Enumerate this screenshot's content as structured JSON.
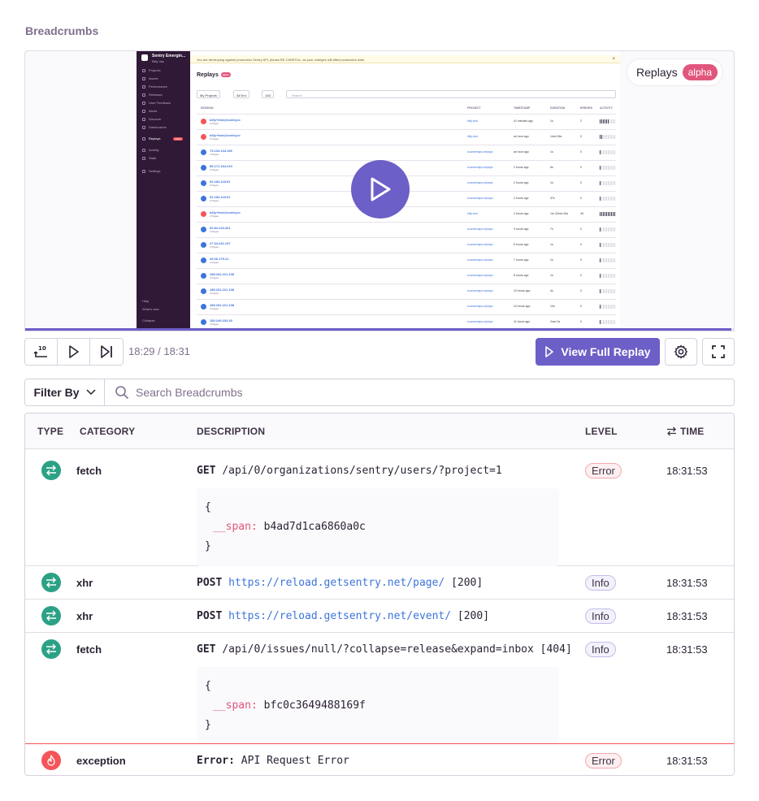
{
  "section_title": "Breadcrumbs",
  "player": {
    "badge_label": "Replays",
    "badge_tag": "alpha",
    "progress": 0.996,
    "timecode": "18:29 / 18:31",
    "view_full_label": "View Full Replay",
    "accent": "#6c5fc7"
  },
  "replay_screenshot": {
    "org_name": "Sentry Emergin...",
    "org_user": "Billy Vaz",
    "nav": [
      "Projects",
      "Issues",
      "Performance",
      "Releases",
      "User Feedback",
      "Alerts",
      "Discover",
      "Dashboards",
      "Replays",
      "Activity",
      "Stats",
      "Settings"
    ],
    "nav_badge": "alpha",
    "footer": [
      "Help",
      "What's new",
      "Collapse"
    ],
    "banner": "You are developing against production Sentry API, please BE CAREFUL, as your changes will affect production data",
    "title": "Replays",
    "title_badge": "alpha",
    "filters": [
      "My Projects",
      "All Env",
      "14D"
    ],
    "search_placeholder": "Search",
    "headers": [
      "SESSION",
      "PROJECT",
      "TIMESTAMP",
      "DURATION",
      "ERRORS",
      "ACTIVITY"
    ],
    "rows": [
      {
        "name": "billy+test@sentry.io",
        "sub": "3 Pages",
        "project": "billy-test",
        "ts": "41 minutes ago",
        "dur": "1s",
        "err": "2",
        "act": 0.6,
        "color": "#f55459"
      },
      {
        "name": "billy+test@sentry.io",
        "sub": "2 Pages",
        "project": "billy-test",
        "ts": "an hour ago",
        "dur": "1min 36s",
        "err": "0",
        "act": 0.2,
        "color": "#f55459"
      },
      {
        "name": "73.134.134.156",
        "sub": "3 Pages",
        "project": "sourcemaps-replays",
        "ts": "an hour ago",
        "dur": "1s",
        "err": "0",
        "act": 0.1,
        "color": "#3d74db"
      },
      {
        "name": "89.171.164.210",
        "sub": "2 Pages",
        "project": "sourcemaps-replays",
        "ts": "2 hours ago",
        "dur": "6s",
        "err": "0",
        "act": 0.1,
        "color": "#3d74db"
      },
      {
        "name": "92.184.118.91",
        "sub": "2 Pages",
        "project": "sourcemaps-replays",
        "ts": "2 hours ago",
        "dur": "1s",
        "err": "0",
        "act": 0.1,
        "color": "#3d74db"
      },
      {
        "name": "92.184.118.91",
        "sub": "2 Pages",
        "project": "sourcemaps-replays",
        "ts": "2 hours ago",
        "dur": "37s",
        "err": "0",
        "act": 0.1,
        "color": "#3d74db"
      },
      {
        "name": "billy+test@sentry.io",
        "sub": "2 Pages",
        "project": "billy-test",
        "ts": "2 hours ago",
        "dur": "1hr 42min 34s",
        "err": "49",
        "act": 1.0,
        "color": "#f55459"
      },
      {
        "name": "60.84.133.201",
        "sub": "2 Pages",
        "project": "sourcemaps-replays",
        "ts": "3 hours ago",
        "dur": "7s",
        "err": "0",
        "act": 0.1,
        "color": "#3d74db"
      },
      {
        "name": "27.34.241.137",
        "sub": "2 Pages",
        "project": "sourcemaps-replays",
        "ts": "6 hours ago",
        "dur": "1s",
        "err": "0",
        "act": 0.1,
        "color": "#3d74db"
      },
      {
        "name": "49.36.179.21",
        "sub": "2 Pages",
        "project": "sourcemaps-replays",
        "ts": "7 hours ago",
        "dur": "1s",
        "err": "0",
        "act": 0.1,
        "color": "#3d74db"
      },
      {
        "name": "185.202.221.108",
        "sub": "2 Pages",
        "project": "sourcemaps-replays",
        "ts": "8 hours ago",
        "dur": "1s",
        "err": "0",
        "act": 0.1,
        "color": "#3d74db"
      },
      {
        "name": "185.202.221.108",
        "sub": "2 Pages",
        "project": "sourcemaps-replays",
        "ts": "10 hours ago",
        "dur": "4s",
        "err": "0",
        "act": 0.1,
        "color": "#3d74db"
      },
      {
        "name": "185.202.221.108",
        "sub": "2 Pages",
        "project": "sourcemaps-replays",
        "ts": "10 hours ago",
        "dur": "10s",
        "err": "0",
        "act": 0.1,
        "color": "#3d74db"
      },
      {
        "name": "180.249.233.49",
        "sub": "2 Pages",
        "project": "sourcemaps-replays",
        "ts": "11 hours ago",
        "dur": "2min 2s",
        "err": "0",
        "act": 0.1,
        "color": "#3d74db"
      }
    ]
  },
  "filter": {
    "label": "Filter By",
    "search_placeholder": "Search Breadcrumbs"
  },
  "table": {
    "headers": {
      "type": "TYPE",
      "category": "CATEGORY",
      "description": "DESCRIPTION",
      "level": "LEVEL",
      "time": "TIME"
    },
    "rows": [
      {
        "category": "fetch",
        "method": "GET",
        "url": "/api/0/organizations/sentry/users/?project=1",
        "suffix": "",
        "link": false,
        "level": "Error",
        "level_kind": "err",
        "time": "18:31:53",
        "icon": "arrows-exchange-icon",
        "color": "#2ba185",
        "data_key": "__span:",
        "data_val": "b4ad7d1ca6860a0c"
      },
      {
        "category": "xhr",
        "method": "POST",
        "url": "https://reload.getsentry.net/page/",
        "suffix": "[200]",
        "link": true,
        "level": "Info",
        "level_kind": "info",
        "time": "18:31:53",
        "icon": "arrows-exchange-icon",
        "color": "#2ba185"
      },
      {
        "category": "xhr",
        "method": "POST",
        "url": "https://reload.getsentry.net/event/",
        "suffix": "[200]",
        "link": true,
        "level": "Info",
        "level_kind": "info",
        "time": "18:31:53",
        "icon": "arrows-exchange-icon",
        "color": "#2ba185"
      },
      {
        "category": "fetch",
        "method": "GET",
        "url": "/api/0/issues/null/?collapse=release&expand=inbox",
        "suffix": "[404]",
        "link": false,
        "level": "Info",
        "level_kind": "info",
        "time": "18:31:53",
        "icon": "arrows-exchange-icon",
        "color": "#2ba185",
        "data_key": "__span:",
        "data_val": "bfc0c3649488169f"
      },
      {
        "category": "exception",
        "method": "Error:",
        "url": "API Request Error",
        "suffix": "",
        "link": false,
        "level": "Error",
        "level_kind": "err",
        "time": "18:31:53",
        "icon": "fire-icon",
        "color": "#f55459"
      }
    ]
  }
}
